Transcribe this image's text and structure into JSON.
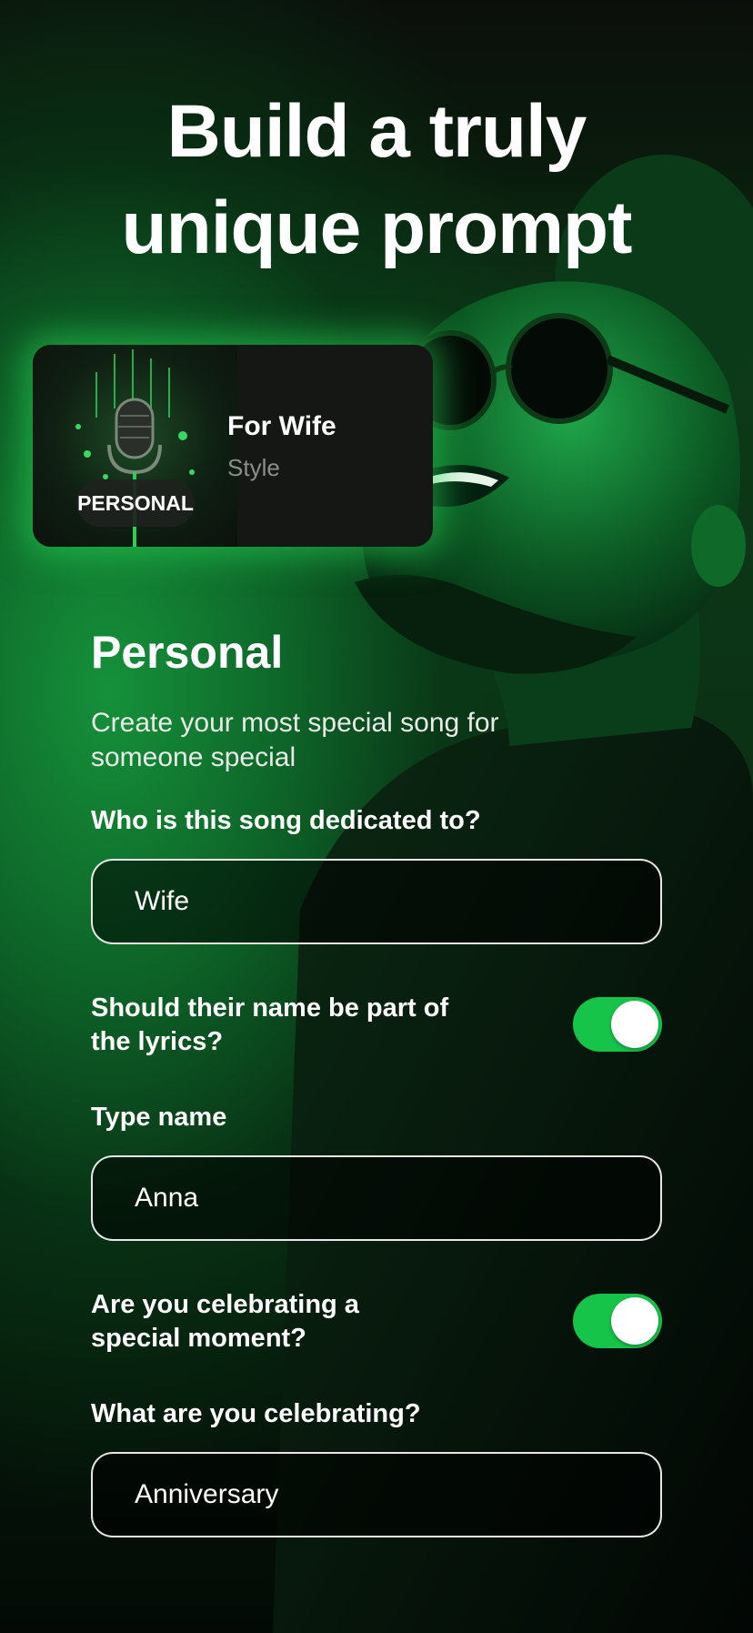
{
  "headline": [
    "Build a truly",
    "unique prompt"
  ],
  "style_card": {
    "badge": "PERSONAL",
    "title": "For Wife",
    "subtitle": "Style"
  },
  "section": {
    "title": "Personal",
    "description": "Create your most special song for someone special"
  },
  "form": {
    "dedicated_label": "Who is this song dedicated to?",
    "dedicated_value": "Wife",
    "name_in_lyrics_label": "Should their name be part of the lyrics?",
    "name_in_lyrics_on": true,
    "type_name_label": "Type name",
    "type_name_value": "Anna",
    "celebrating_label": "Are you celebrating a special moment?",
    "celebrating_on": true,
    "what_celebrating_label": "What are you celebrating?",
    "what_celebrating_value": "Anniversary"
  },
  "colors": {
    "accent_green": "#16c44a",
    "glow_green": "#28dc5a"
  }
}
